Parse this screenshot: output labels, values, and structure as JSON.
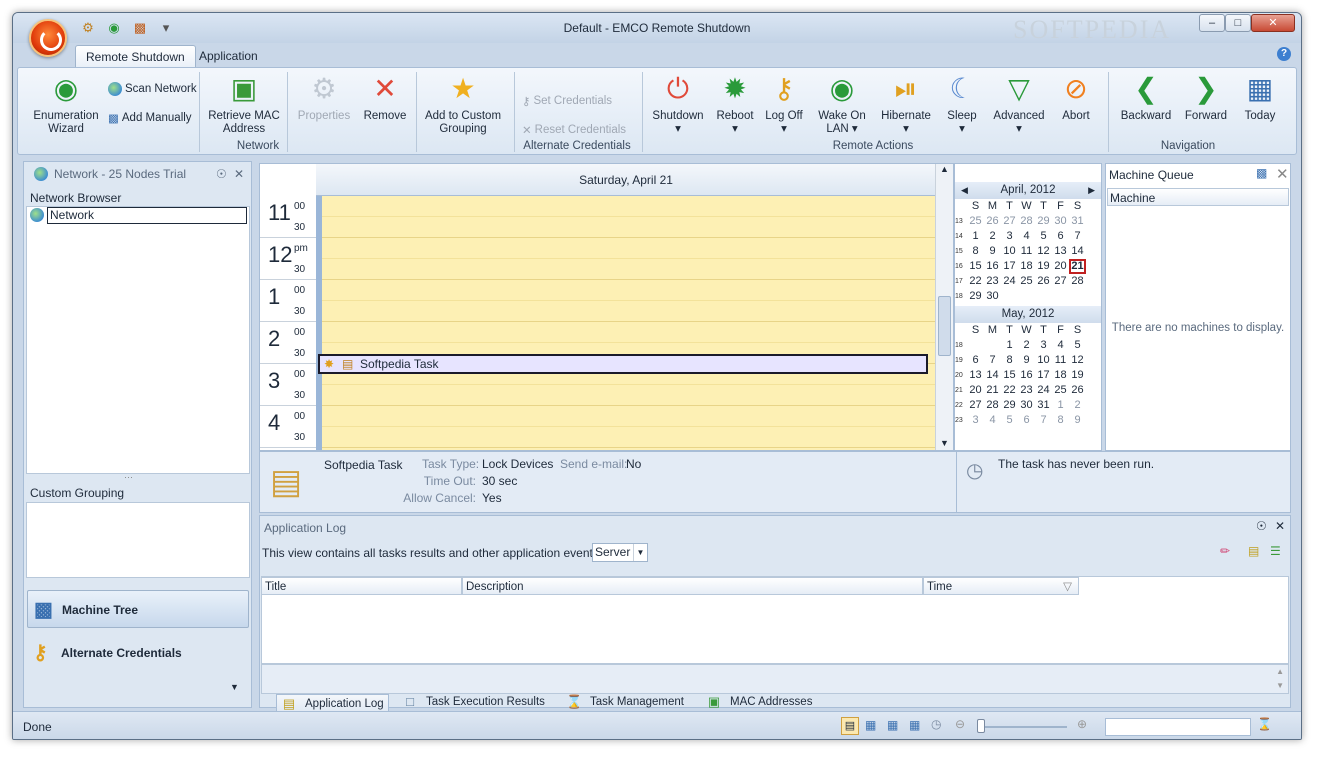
{
  "window": {
    "title": "Default - EMCO Remote Shutdown",
    "watermark": "SOFTPEDIA"
  },
  "quick_access": [
    "settings-icon",
    "wifi-icon",
    "pc-icon",
    "customize-icon"
  ],
  "tabs": {
    "remote_shutdown": "Remote Shutdown",
    "application": "Application"
  },
  "ribbon": {
    "enumeration_wizard": "Enumeration Wizard",
    "scan_network": "Scan Network",
    "add_manually": "Add Manually",
    "retrieve_mac": "Retrieve MAC Address",
    "properties": "Properties",
    "remove": "Remove",
    "add_custom": "Add to Custom Grouping",
    "network_group": "Network",
    "set_credentials": "Set Credentials",
    "reset_credentials": "Reset Credentials",
    "alt_cred_group": "Alternate Credentials",
    "shutdown": "Shutdown",
    "reboot": "Reboot",
    "log_off": "Log Off",
    "wake_on_lan": "Wake On LAN",
    "hibernate": "Hibernate",
    "sleep": "Sleep",
    "advanced": "Advanced",
    "abort": "Abort",
    "remote_actions_group": "Remote Actions",
    "backward": "Backward",
    "forward": "Forward",
    "today": "Today",
    "navigation_group": "Navigation"
  },
  "left_pane": {
    "header": "Network - 25 Nodes Trial",
    "network_browser": "Network Browser",
    "network_node": "Network",
    "custom_grouping": "Custom Grouping",
    "machine_tree": "Machine Tree",
    "alternate_credentials": "Alternate Credentials"
  },
  "calendar": {
    "day_header": "Saturday, April 21",
    "hours": [
      {
        "h": "11",
        "m": "00"
      },
      {
        "h": "12",
        "m": "pm"
      },
      {
        "h": "1",
        "m": "00"
      },
      {
        "h": "2",
        "m": "00"
      },
      {
        "h": "3",
        "m": "00"
      },
      {
        "h": "4",
        "m": "00"
      }
    ],
    "half": "30",
    "task_label": "Softpedia Task"
  },
  "mini_calendar": {
    "april_title": "April, 2012",
    "may_title": "May, 2012",
    "dow": [
      "S",
      "M",
      "T",
      "W",
      "T",
      "F",
      "S"
    ],
    "april": [
      {
        "wk": "13",
        "days": [
          "25",
          "26",
          "27",
          "28",
          "29",
          "30",
          "31"
        ],
        "grey": [
          0,
          1,
          2,
          3,
          4,
          5,
          6
        ]
      },
      {
        "wk": "14",
        "days": [
          "1",
          "2",
          "3",
          "4",
          "5",
          "6",
          "7"
        ],
        "grey": []
      },
      {
        "wk": "15",
        "days": [
          "8",
          "9",
          "10",
          "11",
          "12",
          "13",
          "14"
        ],
        "grey": []
      },
      {
        "wk": "16",
        "days": [
          "15",
          "16",
          "17",
          "18",
          "19",
          "20",
          "21"
        ],
        "grey": [],
        "today": 6
      },
      {
        "wk": "17",
        "days": [
          "22",
          "23",
          "24",
          "25",
          "26",
          "27",
          "28"
        ],
        "grey": []
      },
      {
        "wk": "18",
        "days": [
          "29",
          "30",
          "",
          "",
          "",
          "",
          ""
        ],
        "grey": []
      }
    ],
    "may": [
      {
        "wk": "18",
        "days": [
          "",
          "",
          "1",
          "2",
          "3",
          "4",
          "5"
        ],
        "grey": []
      },
      {
        "wk": "19",
        "days": [
          "6",
          "7",
          "8",
          "9",
          "10",
          "11",
          "12"
        ],
        "grey": []
      },
      {
        "wk": "20",
        "days": [
          "13",
          "14",
          "15",
          "16",
          "17",
          "18",
          "19"
        ],
        "grey": []
      },
      {
        "wk": "21",
        "days": [
          "20",
          "21",
          "22",
          "23",
          "24",
          "25",
          "26"
        ],
        "grey": []
      },
      {
        "wk": "22",
        "days": [
          "27",
          "28",
          "29",
          "30",
          "31",
          "1",
          "2"
        ],
        "grey": [
          5,
          6
        ]
      },
      {
        "wk": "23",
        "days": [
          "3",
          "4",
          "5",
          "6",
          "7",
          "8",
          "9"
        ],
        "grey": [
          0,
          1,
          2,
          3,
          4,
          5,
          6
        ]
      }
    ]
  },
  "machine_queue": {
    "title": "Machine Queue",
    "column": "Machine",
    "empty": "There are no machines to display."
  },
  "details": {
    "task_name": "Softpedia Task",
    "task_type_label": "Task Type:",
    "task_type": "Lock Devices",
    "send_email_label": "Send e-mail:",
    "send_email": "No",
    "timeout_label": "Time Out:",
    "timeout": "30 sec",
    "allow_cancel_label": "Allow Cancel:",
    "allow_cancel": "Yes",
    "run_status": "The task has never been run."
  },
  "app_log": {
    "title": "Application Log",
    "filter_text": "This view contains all tasks results and other application events for:",
    "server": "Server",
    "col_title": "Title",
    "col_description": "Description",
    "col_time": "Time"
  },
  "bottom_tabs": {
    "application_log": "Application Log",
    "task_execution": "Task Execution Results",
    "task_management": "Task Management",
    "mac_addresses": "MAC Addresses"
  },
  "status": {
    "text": "Done",
    "zoom_percent": 0
  }
}
